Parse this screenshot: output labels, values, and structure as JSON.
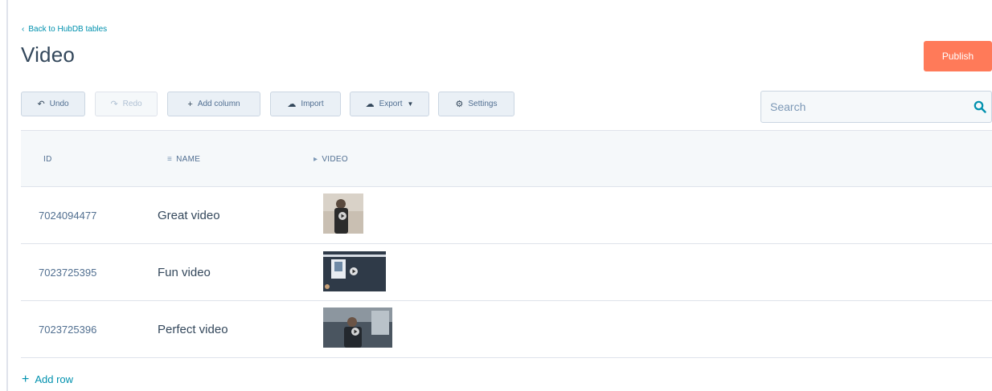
{
  "nav": {
    "back_label": "Back to HubDB tables"
  },
  "page": {
    "title": "Video"
  },
  "actions": {
    "publish_label": "Publish"
  },
  "toolbar": {
    "undo_label": "Undo",
    "redo_label": "Redo",
    "add_column_label": "Add column",
    "import_label": "Import",
    "export_label": "Export",
    "settings_label": "Settings"
  },
  "search": {
    "placeholder": "Search"
  },
  "table": {
    "headers": {
      "id": "ID",
      "name": "NAME",
      "video": "VIDEO"
    },
    "rows": [
      {
        "id": "7024094477",
        "name": "Great video"
      },
      {
        "id": "7023725395",
        "name": "Fun video"
      },
      {
        "id": "7023725396",
        "name": "Perfect video"
      }
    ]
  },
  "footer": {
    "add_row_label": "Add row"
  },
  "colors": {
    "accent": "#0091ae",
    "publish": "#ff7a59",
    "text": "#33475b",
    "header_bg": "#f5f8fa",
    "border": "#dfe3eb"
  }
}
